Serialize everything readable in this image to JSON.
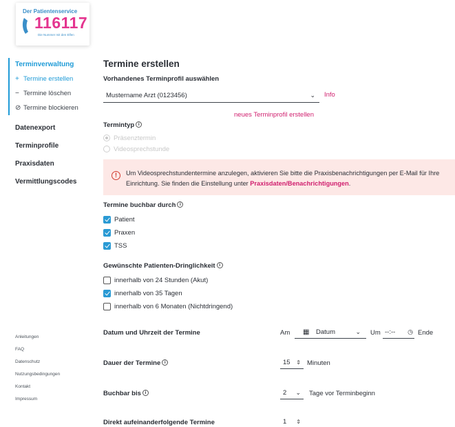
{
  "logo": {
    "top_line": "Der Patientenservice",
    "number": "116117",
    "tagline": "Die Nummer mit den Elfen"
  },
  "sidebar": {
    "section_title": "Terminverwaltung",
    "sub_items": [
      {
        "label": "Termine erstellen",
        "icon": "plus-icon"
      },
      {
        "label": "Termine löschen",
        "icon": "minus-icon"
      },
      {
        "label": "Termine blockieren",
        "icon": "block-icon"
      }
    ],
    "main_items": [
      "Datenexport",
      "Terminprofile",
      "Praxisdaten",
      "Vermittlungscodes"
    ],
    "footer_links": [
      "Anleitungen",
      "FAQ",
      "Datenschutz",
      "Nutzungsbedingungen",
      "Kontakt",
      "Impressum"
    ]
  },
  "main": {
    "title": "Termine erstellen",
    "profile_label": "Vorhandenes Terminprofil auswählen",
    "profile_value": "Mustername Arzt (0123456)",
    "info_link": "Info",
    "new_profile_link": "neues Terminprofil erstellen",
    "termintyp_label": "Termintyp",
    "termintyp_options": [
      "Präsenztermin",
      "Videosprechstunde"
    ],
    "alert_text": "Um Videosprechstundentermine anzulegen, aktivieren Sie bitte die Praxisbenachrichtigungen per E-Mail für Ihre Einrichtung. Sie finden die Einstellung unter ",
    "alert_link": "Praxisdaten/Benachrichtigungen",
    "alert_end": ".",
    "bookable_label": "Termine buchbar durch",
    "bookable_options": [
      {
        "label": "Patient",
        "checked": true
      },
      {
        "label": "Praxen",
        "checked": true
      },
      {
        "label": "TSS",
        "checked": true
      }
    ],
    "urgency_label": "Gewünschte Patienten-Dringlichkeit",
    "urgency_options": [
      {
        "label": "innerhalb von 24 Stunden (Akut)",
        "checked": false
      },
      {
        "label": "innerhalb von 35 Tagen",
        "checked": true
      },
      {
        "label": "innerhalb von 6 Monaten (Nichtdringend)",
        "checked": false
      }
    ],
    "datetime_label": "Datum und Uhrzeit der Termine",
    "am": "Am",
    "date_placeholder": "Datum",
    "um": "Um",
    "time_placeholder": "--:--",
    "ende": "Ende",
    "duration_label": "Dauer der Termine",
    "duration_value": "15",
    "duration_unit": "Minuten",
    "bookable_until_label": "Buchbar bis",
    "bookable_until_value": "2",
    "bookable_until_unit": "Tage vor Terminbeginn",
    "consecutive_label": "Direkt aufeinanderfolgende Termine",
    "consecutive_value": "1"
  },
  "colors": {
    "accent_blue": "#1f9bd7",
    "link_pink": "#d01f6e",
    "alert_bg": "#fde8e6",
    "alert_icon": "#d23b2f"
  }
}
